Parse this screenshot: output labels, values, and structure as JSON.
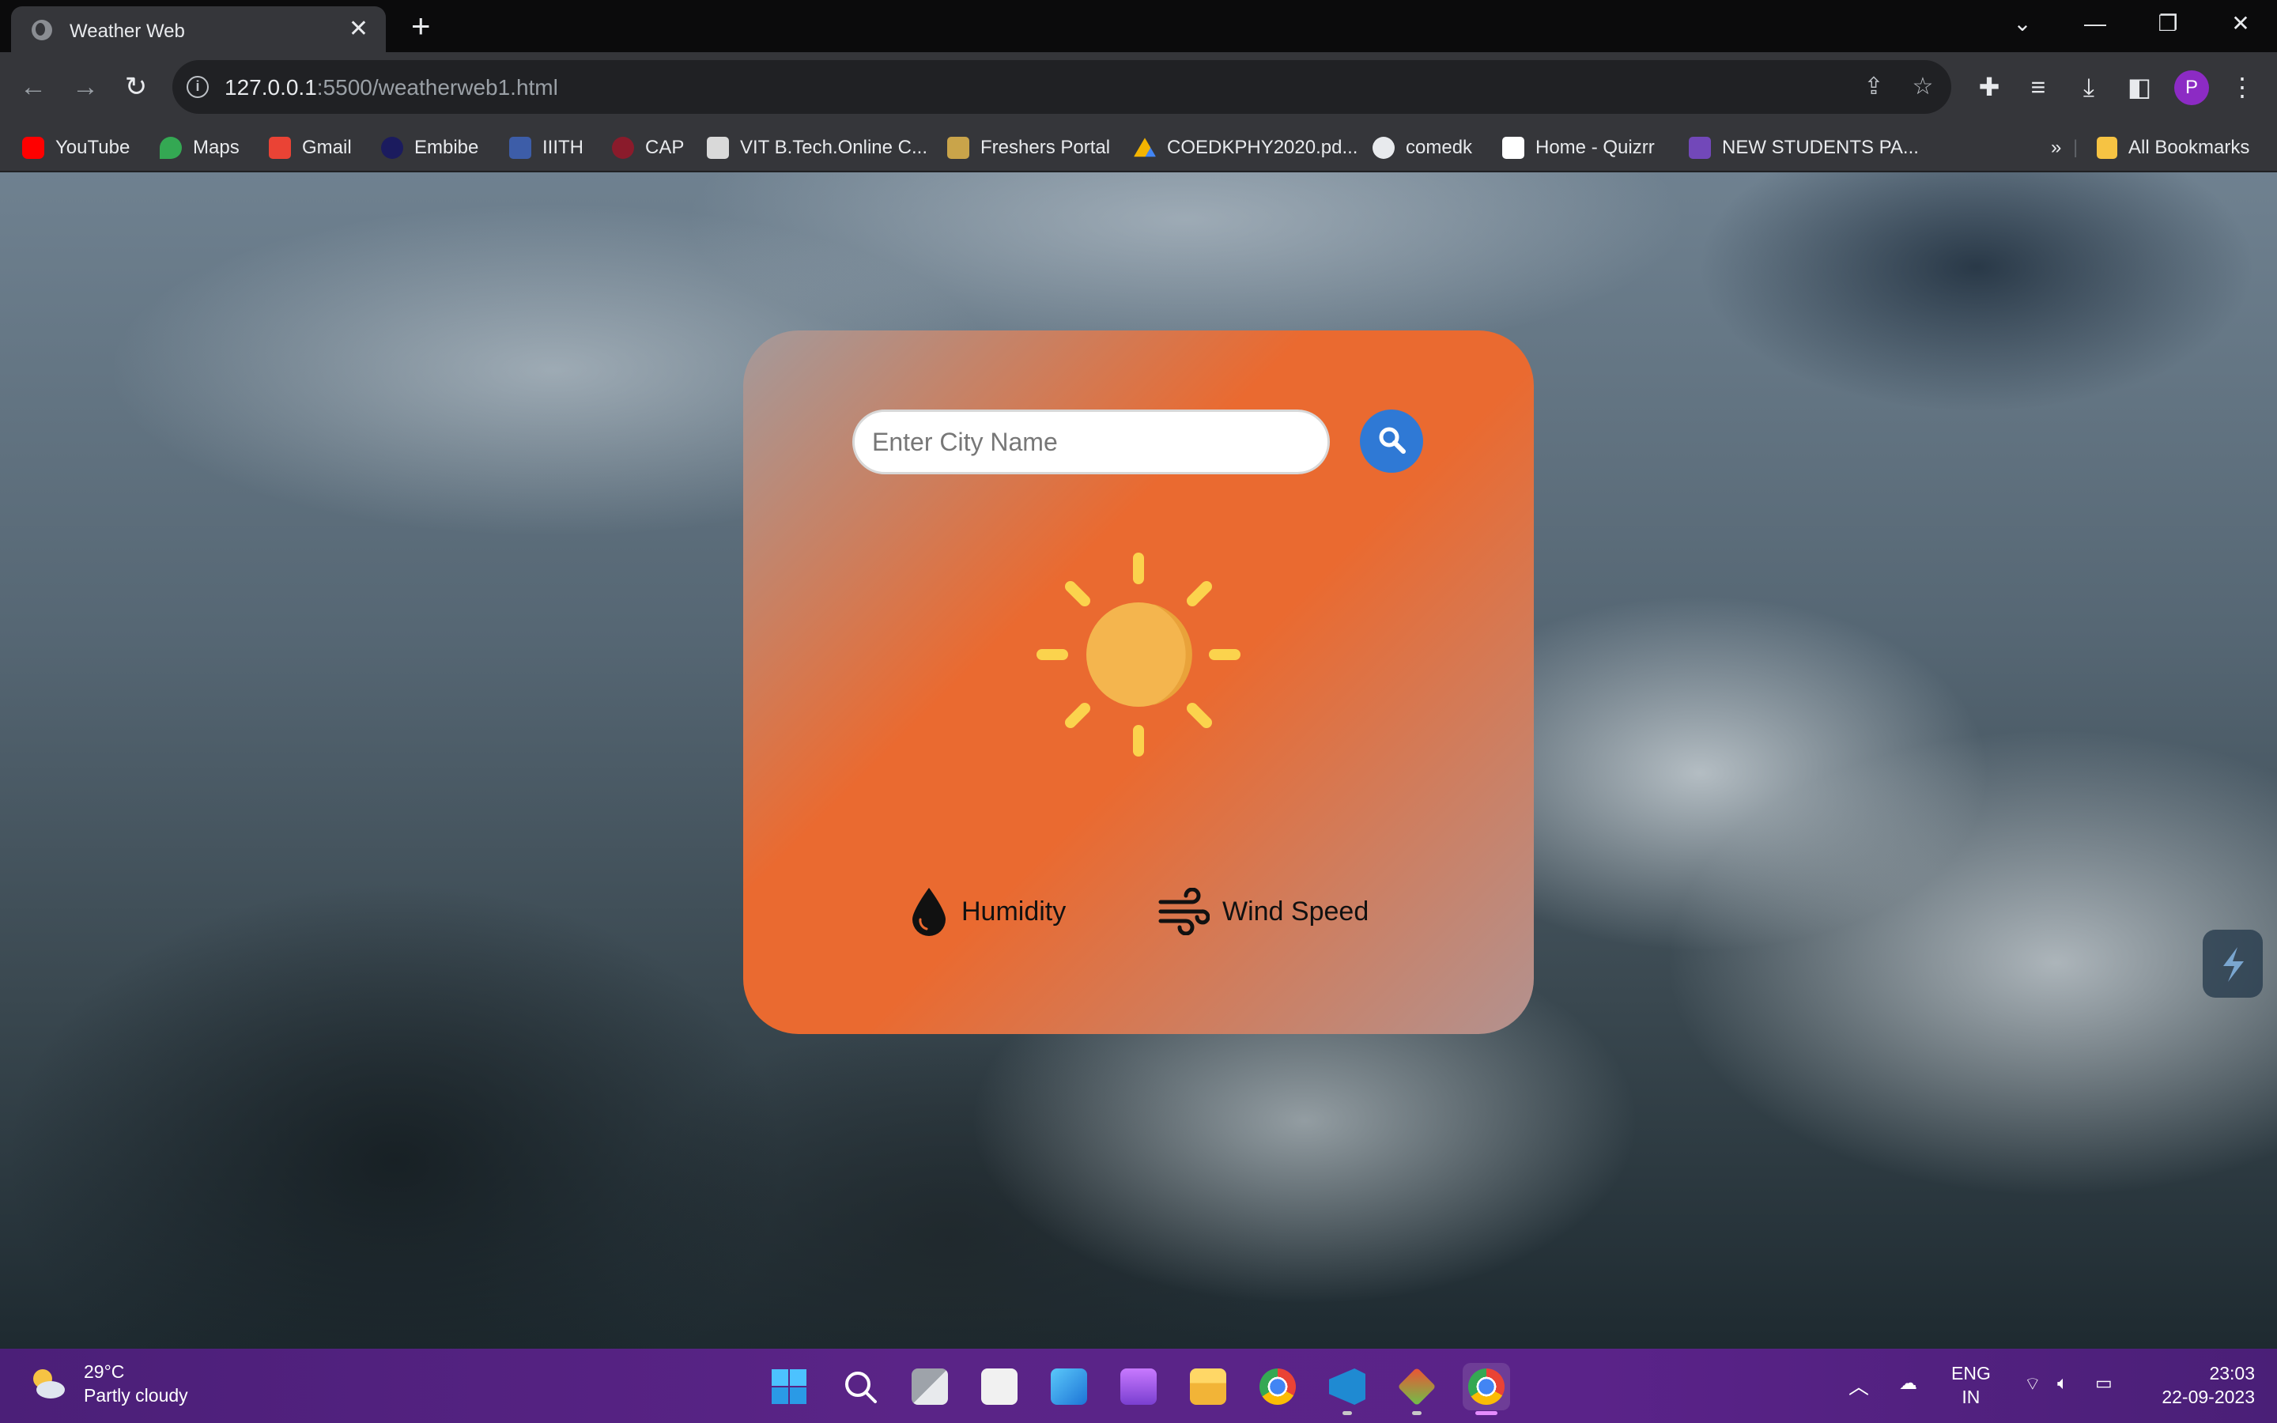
{
  "browser": {
    "tab_title": "Weather Web",
    "tab_close": "✕",
    "new_tab": "+",
    "url_host": "127.0.0.1",
    "url_rest": ":5500/weatherweb1.html",
    "profile_initial": "P",
    "bookmarks": [
      {
        "label": "YouTube",
        "icon": "youtube-icon",
        "color": "#ff0000"
      },
      {
        "label": "Maps",
        "icon": "maps-icon",
        "color": "#34a853"
      },
      {
        "label": "Gmail",
        "icon": "gmail-icon",
        "color": "#ea4335"
      },
      {
        "label": "Embibe",
        "icon": "embibe-icon",
        "color": "#1b1b5e"
      },
      {
        "label": "IIITH",
        "icon": "iiith-icon",
        "color": "#3d5da8"
      },
      {
        "label": "CAP",
        "icon": "cap-icon",
        "color": "#8a1b2b"
      },
      {
        "label": "VIT B.Tech.Online C...",
        "icon": "vit-icon",
        "color": "#d9d9d9"
      },
      {
        "label": "Freshers Portal",
        "icon": "freshers-icon",
        "color": "#c9a44a"
      },
      {
        "label": "COEDKPHY2020.pd...",
        "icon": "google-drive-icon",
        "color": "#f4b400"
      },
      {
        "label": "comedk",
        "icon": "globe-icon",
        "color": "#e8eaed"
      },
      {
        "label": "Home - Quizrr",
        "icon": "quizrr-icon",
        "color": "#ffffff"
      },
      {
        "label": "NEW STUDENTS PA...",
        "icon": "forms-icon",
        "color": "#7248b9"
      }
    ],
    "more_bookmarks": "»",
    "all_bookmarks": "All Bookmarks"
  },
  "weather_app": {
    "search_placeholder": "Enter City Name",
    "search_value": "",
    "weather_icon": "sun-icon",
    "humidity_label": "Humidity",
    "wind_label": "Wind Speed",
    "colors": {
      "card_accent": "#ea6a30",
      "search_button": "#2f79d5",
      "sun": "#f4b54e"
    }
  },
  "taskbar": {
    "weather_temp": "29°C",
    "weather_desc": "Partly cloudy",
    "lang_top": "ENG",
    "lang_bottom": "IN",
    "time": "23:03",
    "date": "22-09-2023",
    "apps": [
      "windows-start-icon",
      "search-icon",
      "task-view-icon",
      "notepad-icon",
      "photos-icon",
      "clipchamp-icon",
      "file-explorer-icon",
      "chrome-icon",
      "vscode-icon",
      "git-icon",
      "chrome-profile-icon"
    ]
  }
}
